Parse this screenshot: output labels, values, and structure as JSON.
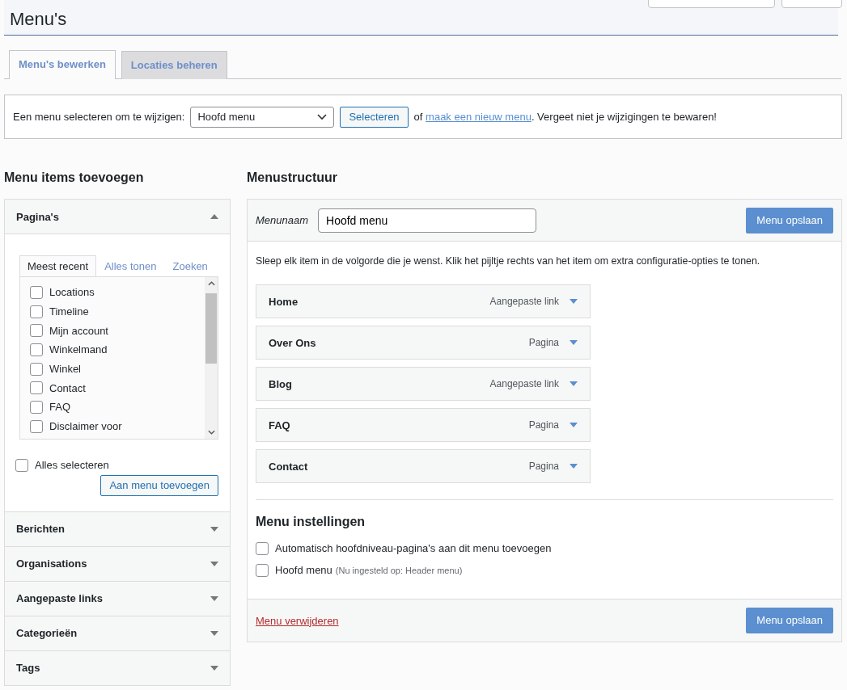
{
  "page_title": "Menu's",
  "tabs": [
    {
      "label": "Menu's bewerken",
      "selected": true
    },
    {
      "label": "Locaties beheren",
      "selected": false
    }
  ],
  "select_bar": {
    "label": "Een menu selecteren om te wijzigen:",
    "dropdown": "Hoofd menu",
    "button": "Selecteren",
    "text_before_link": "of",
    "link": "maak een nieuw menu",
    "text_after_link": ". Vergeet niet je wijzigingen te bewaren!"
  },
  "add_items": {
    "heading": "Menu items toevoegen",
    "sections": [
      {
        "title": "Pagina's",
        "expanded": true,
        "tabs": [
          {
            "label": "Meest recent",
            "selected": true
          },
          {
            "label": "Alles tonen",
            "selected": false
          },
          {
            "label": "Zoeken",
            "selected": false
          }
        ],
        "items": [
          {
            "label": "Locations",
            "checked": false
          },
          {
            "label": "Timeline",
            "checked": false
          },
          {
            "label": "Mijn account",
            "checked": false
          },
          {
            "label": "Winkelmand",
            "checked": false
          },
          {
            "label": "Winkel",
            "checked": false
          },
          {
            "label": "Contact",
            "checked": false
          },
          {
            "label": "FAQ",
            "checked": false
          },
          {
            "label": "Disclaimer voor",
            "checked": false
          }
        ],
        "select_all": {
          "label": "Alles selecteren",
          "checked": false
        },
        "add_button": "Aan menu toevoegen"
      },
      {
        "title": "Berichten",
        "expanded": false
      },
      {
        "title": "Organisations",
        "expanded": false
      },
      {
        "title": "Aangepaste links",
        "expanded": false
      },
      {
        "title": "Categorieën",
        "expanded": false
      },
      {
        "title": "Tags",
        "expanded": false
      }
    ]
  },
  "structure": {
    "heading": "Menustructuur",
    "name_label": "Menunaam",
    "name_value": "Hoofd menu",
    "save_button": "Menu opslaan",
    "instructions": "Sleep elk item in de volgorde die je wenst. Klik het pijltje rechts van het item om extra configuratie-opties te tonen.",
    "items": [
      {
        "title": "Home",
        "type": "Aangepaste link"
      },
      {
        "title": "Over Ons",
        "type": "Pagina"
      },
      {
        "title": "Blog",
        "type": "Aangepaste link"
      },
      {
        "title": "FAQ",
        "type": "Pagina"
      },
      {
        "title": "Contact",
        "type": "Pagina"
      }
    ],
    "settings": {
      "heading": "Menu instellingen",
      "options": [
        {
          "label": "Automatisch hoofdniveau-pagina's aan dit menu toevoegen",
          "checked": false
        },
        {
          "label": "Hoofd menu",
          "note": "(Nu ingesteld op: Header menu)",
          "checked": false
        }
      ]
    },
    "delete_link": "Menu verwijderen",
    "save_button_bottom": "Menu opslaan"
  }
}
